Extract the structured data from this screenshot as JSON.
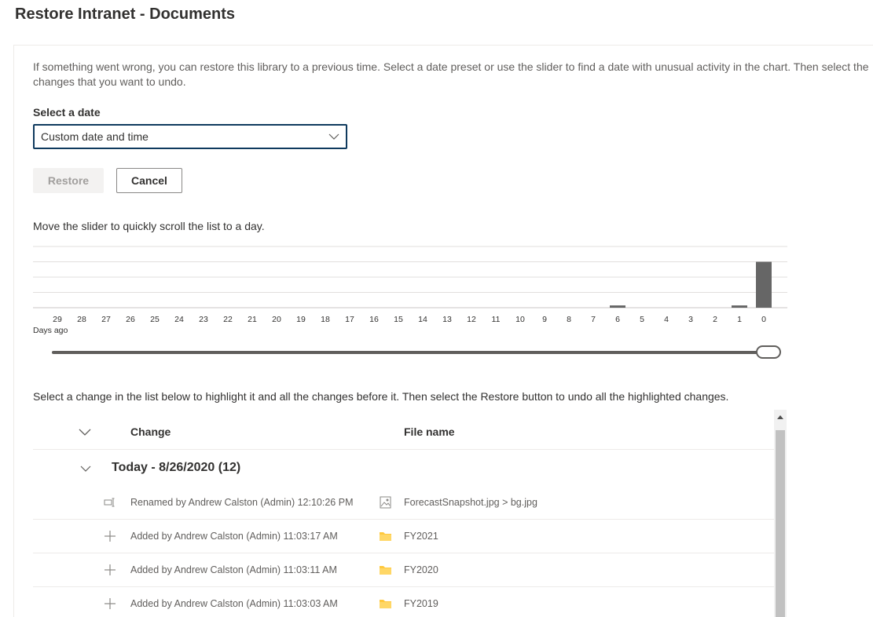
{
  "page": {
    "title": "Restore Intranet - Documents",
    "intro": "If something went wrong, you can restore this library to a previous time. Select a date preset or use the slider to find a date with unusual activity in the chart. Then select the changes that you want to undo."
  },
  "date_select": {
    "label": "Select a date",
    "value": "Custom date and time"
  },
  "buttons": {
    "restore": "Restore",
    "cancel": "Cancel"
  },
  "slider": {
    "caption": "Move the slider to quickly scroll the list to a day.",
    "position": 1.0
  },
  "chart_data": {
    "type": "bar",
    "categories": [
      "29",
      "28",
      "27",
      "26",
      "25",
      "24",
      "23",
      "22",
      "21",
      "20",
      "19",
      "18",
      "17",
      "16",
      "15",
      "14",
      "13",
      "12",
      "11",
      "10",
      "9",
      "8",
      "7",
      "6",
      "5",
      "4",
      "3",
      "2",
      "1",
      "0"
    ],
    "values": [
      0,
      0,
      0,
      0,
      0,
      0,
      0,
      0,
      0,
      0,
      0,
      0,
      0,
      0,
      0,
      0,
      0,
      0,
      0,
      0,
      0,
      0,
      0,
      0.15,
      0,
      0,
      0,
      0,
      0.15,
      3
    ],
    "title": "",
    "xlabel": "Days ago",
    "ylabel": "",
    "ylim": [
      0,
      4
    ],
    "grid": true,
    "bar_color": "#666666"
  },
  "list": {
    "instruction": "Select a change in the list below to highlight it and all the changes before it. Then select the Restore button to undo all the highlighted changes.",
    "columns": {
      "change": "Change",
      "file": "File name"
    },
    "group": {
      "title": "Today - 8/26/2020 (12)"
    },
    "rows": [
      {
        "icon": "rename-icon",
        "change": "Renamed by Andrew Calston (Admin) 12:10:26 PM",
        "file_icon": "image-file-icon",
        "file": "ForecastSnapshot.jpg > bg.jpg"
      },
      {
        "icon": "add-icon",
        "change": "Added by Andrew Calston (Admin) 11:03:17 AM",
        "file_icon": "folder-icon",
        "file": "FY2021"
      },
      {
        "icon": "add-icon",
        "change": "Added by Andrew Calston (Admin) 11:03:11 AM",
        "file_icon": "folder-icon",
        "file": "FY2020"
      },
      {
        "icon": "add-icon",
        "change": "Added by Andrew Calston (Admin) 11:03:03 AM",
        "file_icon": "folder-icon",
        "file": "FY2019"
      }
    ]
  },
  "colors": {
    "accent_border": "#0f3a5e",
    "folder": "#ffc83d"
  }
}
